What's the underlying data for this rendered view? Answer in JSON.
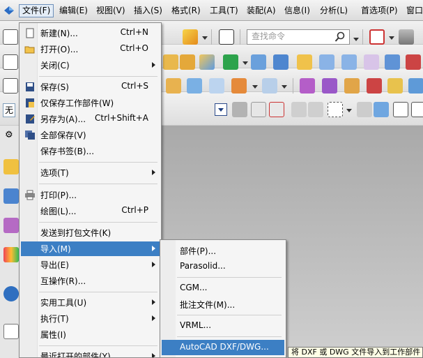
{
  "menubar": {
    "items": [
      "文件(F)",
      "编辑(E)",
      "视图(V)",
      "插入(S)",
      "格式(R)",
      "工具(T)",
      "装配(A)",
      "信息(I)",
      "分析(L)",
      "首选项(P)",
      "窗口"
    ]
  },
  "toolbar": {
    "search_placeholder": "查找命令",
    "filter_value": "无"
  },
  "file_menu": {
    "items": [
      {
        "label": "新建(N)...",
        "shortcut": "Ctrl+N",
        "icon": "new-file-icon"
      },
      {
        "label": "打开(O)...",
        "shortcut": "Ctrl+O",
        "icon": "open-folder-icon"
      },
      {
        "label": "关闭(C)",
        "shortcut": "",
        "icon": "",
        "submenu": true
      },
      {
        "label": "保存(S)",
        "shortcut": "Ctrl+S",
        "icon": "save-icon"
      },
      {
        "label": "仅保存工作部件(W)",
        "shortcut": "",
        "icon": "save-work-part-icon"
      },
      {
        "label": "另存为(A)...",
        "shortcut": "Ctrl+Shift+A",
        "icon": "save-as-icon"
      },
      {
        "label": "全部保存(V)",
        "shortcut": "",
        "icon": "save-all-icon"
      },
      {
        "label": "保存书签(B)...",
        "shortcut": "",
        "icon": ""
      },
      {
        "label": "选项(T)",
        "shortcut": "",
        "icon": "",
        "submenu": true
      },
      {
        "label": "打印(P)...",
        "shortcut": "",
        "icon": "print-icon"
      },
      {
        "label": "绘图(L)...",
        "shortcut": "Ctrl+P",
        "icon": ""
      },
      {
        "label": "发送到打包文件(K)",
        "shortcut": "",
        "icon": ""
      },
      {
        "label": "导入(M)",
        "shortcut": "",
        "icon": "",
        "submenu": true,
        "highlighted": true
      },
      {
        "label": "导出(E)",
        "shortcut": "",
        "icon": "",
        "submenu": true
      },
      {
        "label": "互操作(R)...",
        "shortcut": "",
        "icon": ""
      },
      {
        "label": "实用工具(U)",
        "shortcut": "",
        "icon": "",
        "submenu": true
      },
      {
        "label": "执行(T)",
        "shortcut": "",
        "icon": "",
        "submenu": true
      },
      {
        "label": "属性(I)",
        "shortcut": "",
        "icon": ""
      },
      {
        "label": "最近打开的部件(Y)",
        "shortcut": "",
        "icon": "",
        "submenu": true
      }
    ]
  },
  "import_menu": {
    "items": [
      {
        "label": "部件(P)..."
      },
      {
        "label": "Parasolid..."
      },
      {
        "label": "CGM..."
      },
      {
        "label": "批注文件(M)..."
      },
      {
        "label": "VRML..."
      },
      {
        "label": "AutoCAD DXF/DWG...",
        "highlighted": true
      }
    ]
  },
  "tooltip": {
    "text": "将 DXF 或 DWG 文件导入到工作部件"
  }
}
